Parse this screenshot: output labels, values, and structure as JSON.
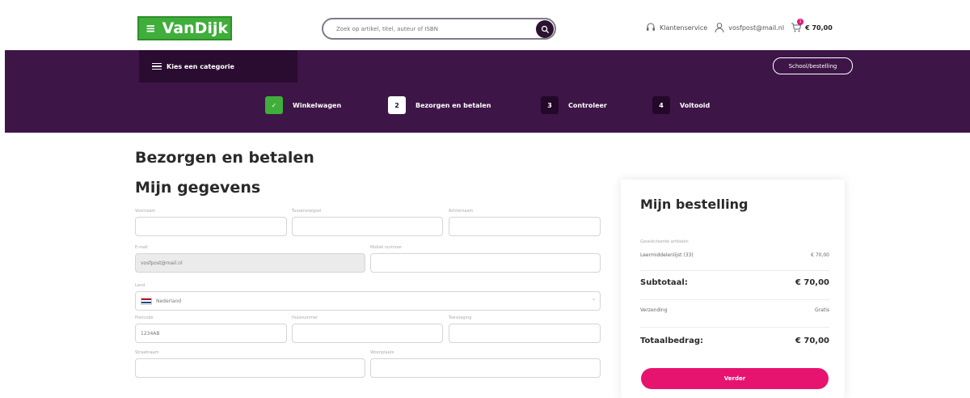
{
  "header": {
    "brand": "VanDijk",
    "search_placeholder": "Zoek op artikel, titel, auteur of ISBN",
    "customer_service": "Klantenservice",
    "account": "vosfpost@mail.nl",
    "cart_count": "1",
    "cart_total": "€ 70,00"
  },
  "nav": {
    "category_label": "Kies een categorie",
    "school_label": "School/bestelling",
    "steps": [
      {
        "num": "✓",
        "label": "Winkelwagen"
      },
      {
        "num": "2",
        "label": "Bezorgen en betalen"
      },
      {
        "num": "3",
        "label": "Controleer"
      },
      {
        "num": "4",
        "label": "Voltooid"
      }
    ]
  },
  "page": {
    "title": "Bezorgen en betalen",
    "section": "Mijn gegevens"
  },
  "form": {
    "first_name_label": "Voornaam",
    "middle_name_label": "Tussenvoegsel",
    "last_name_label": "Achternaam",
    "email_label": "E-mail",
    "email_value": "vosfpost@mail.nl",
    "phone_label": "Mobiel nummer",
    "country_label": "Land",
    "country_value": "Nederland",
    "postcode_label": "Postcode",
    "postcode_value": "1234AB",
    "house_number_label": "Huisnummer",
    "addition_label": "Toevoeging",
    "street_label": "Straatnaam",
    "city_label": "Woonplaats"
  },
  "order": {
    "title": "Mijn bestelling",
    "list_label": "Geselecteerde artikelen",
    "item_name": "Leermiddelenlijst (33)",
    "item_price": "€ 70,00",
    "subtotal_label": "Subtotaal:",
    "subtotal_value": "€ 70,00",
    "shipping_label": "Verzending",
    "shipping_value": "Gratis",
    "total_label": "Totaalbedrag:",
    "total_value": "€ 70,00",
    "next_button": "Verder"
  },
  "colors": {
    "brand_green": "#3fae3a",
    "nav_purple": "#3d1647",
    "accent_pink": "#e6136f"
  }
}
